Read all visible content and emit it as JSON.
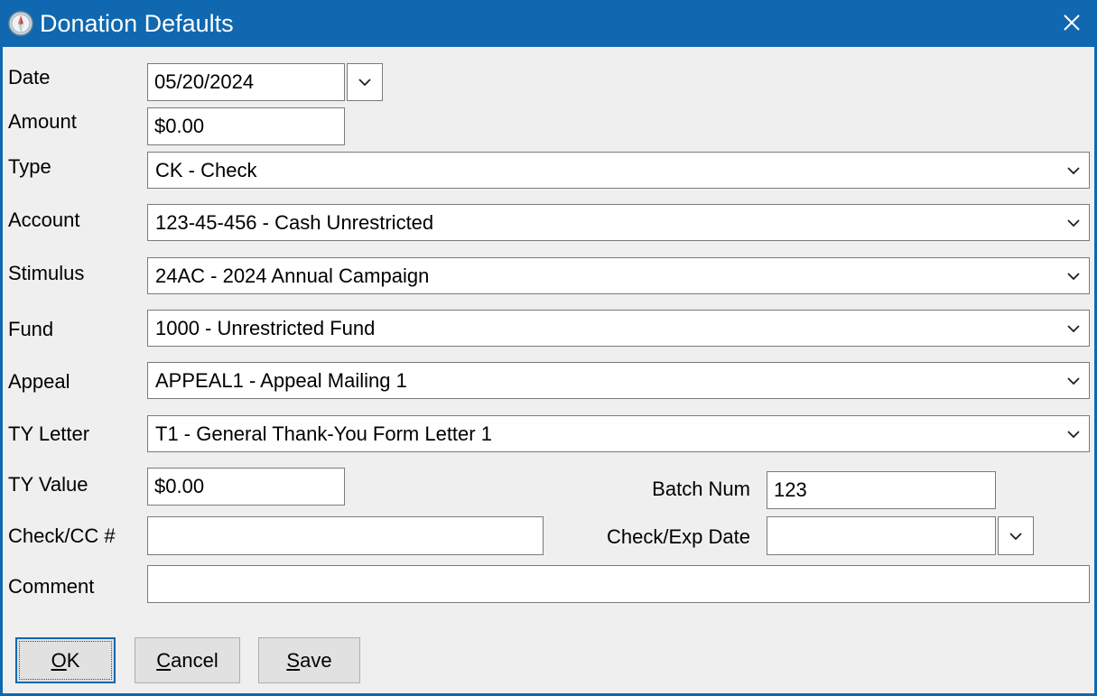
{
  "window": {
    "title": "Donation Defaults",
    "icon": "compass-icon",
    "close_label": "✕",
    "accent_color": "#0f68b0",
    "background_color": "#efefef"
  },
  "form": {
    "fields": [
      {
        "label": "Date",
        "value": "05/20/2024",
        "control": "date",
        "has_dropdown_button": true
      },
      {
        "label": "Amount",
        "value": "$0.00",
        "control": "textbox"
      },
      {
        "label": "Type",
        "value": "CK - Check",
        "control": "combobox"
      },
      {
        "label": "Account",
        "value": "123-45-456 - Cash Unrestricted",
        "control": "combobox"
      },
      {
        "label": "Stimulus",
        "value": "24AC - 2024 Annual Campaign",
        "control": "combobox"
      },
      {
        "label": "Fund",
        "value": "1000 - Unrestricted Fund",
        "control": "combobox"
      },
      {
        "label": "Appeal",
        "value": "APPEAL1 - Appeal Mailing 1",
        "control": "combobox"
      },
      {
        "label": "TY Letter",
        "value": "T1 - General Thank-You Form Letter 1",
        "control": "combobox"
      },
      {
        "label": "TY Value",
        "value": "$0.00",
        "control": "textbox"
      },
      {
        "label": "Batch Num",
        "value": "123",
        "control": "textbox"
      },
      {
        "label": "Check/CC #",
        "value": "",
        "control": "textbox"
      },
      {
        "label": "Check/Exp Date",
        "value": "",
        "control": "date",
        "has_dropdown_button": true
      },
      {
        "label": "Comment",
        "value": "",
        "control": "textbox"
      }
    ]
  },
  "buttons": {
    "ok": {
      "label": "OK",
      "accel": "O",
      "rest": "K",
      "is_default": true
    },
    "cancel": {
      "label": "Cancel",
      "accel": "C",
      "rest": "ancel",
      "is_default": false
    },
    "save": {
      "label": "Save",
      "accel": "S",
      "rest": "ave",
      "is_default": false
    }
  }
}
